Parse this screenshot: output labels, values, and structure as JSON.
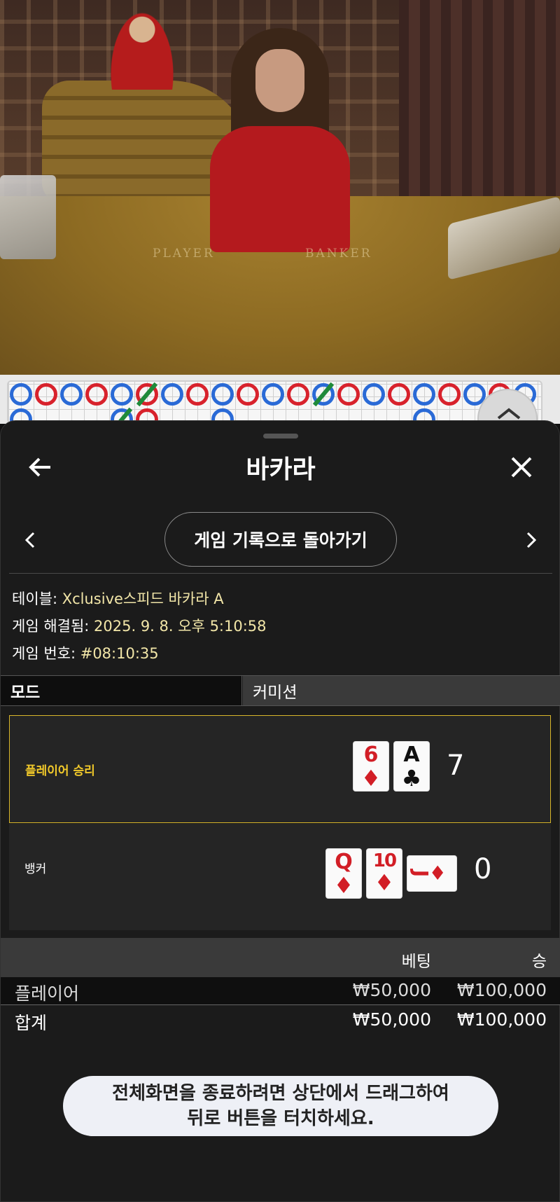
{
  "video": {
    "felt_player": "PLAYER",
    "felt_banker": "BANKER"
  },
  "roadmap": {
    "beads_top": [
      "b",
      "r",
      "b",
      "r",
      "b",
      "r",
      "b",
      "r",
      "b",
      "r",
      "b",
      "r",
      "b",
      "r",
      "b",
      "r",
      "b",
      "r",
      "b",
      "r",
      "b"
    ],
    "beads_bottom": [
      "b",
      "",
      "",
      "",
      "b",
      "r",
      "",
      "",
      "b",
      "",
      "",
      "",
      "",
      "",
      "",
      "",
      "b"
    ]
  },
  "sheet": {
    "title": "바카라",
    "back_icon": "arrow-left-icon",
    "close_icon": "close-icon",
    "history_button": "게임 기록으로 돌아가기",
    "info": {
      "table_label": "테이블: ",
      "table_value": "Xclusive스피드 바카라 A",
      "resolved_label": "게임 해결됨: ",
      "resolved_value": "2025. 9. 8. 오후 5:10:58",
      "number_label": "게임 번호: ",
      "number_value": "#08:10:35"
    },
    "mode": {
      "left": "모드",
      "right": "커미션"
    },
    "results": {
      "player": {
        "label": "플레이어 승리",
        "cards": [
          {
            "rank": "6",
            "suit": "♦",
            "color": "red"
          },
          {
            "rank": "A",
            "suit": "♣",
            "color": "black"
          }
        ],
        "score": "7"
      },
      "banker": {
        "label": "뱅커",
        "cards": [
          {
            "rank": "Q",
            "suit": "♦",
            "color": "red"
          },
          {
            "rank": "10",
            "suit": "♦",
            "color": "red"
          },
          {
            "rank": "J",
            "suit": "♦",
            "color": "red",
            "sideways": true
          }
        ],
        "score": "0"
      }
    },
    "bets": {
      "col_bet": "베팅",
      "col_win": "승",
      "rows": [
        {
          "name": "플레이어",
          "bet": "₩50,000",
          "win": "₩100,000"
        },
        {
          "name": "합계",
          "bet": "₩50,000",
          "win": "₩100,000"
        }
      ]
    },
    "toast": {
      "line1": "전체화면을 종료하려면 상단에서 드래그하여",
      "line2": "뒤로 버튼을 터치하세요."
    }
  }
}
